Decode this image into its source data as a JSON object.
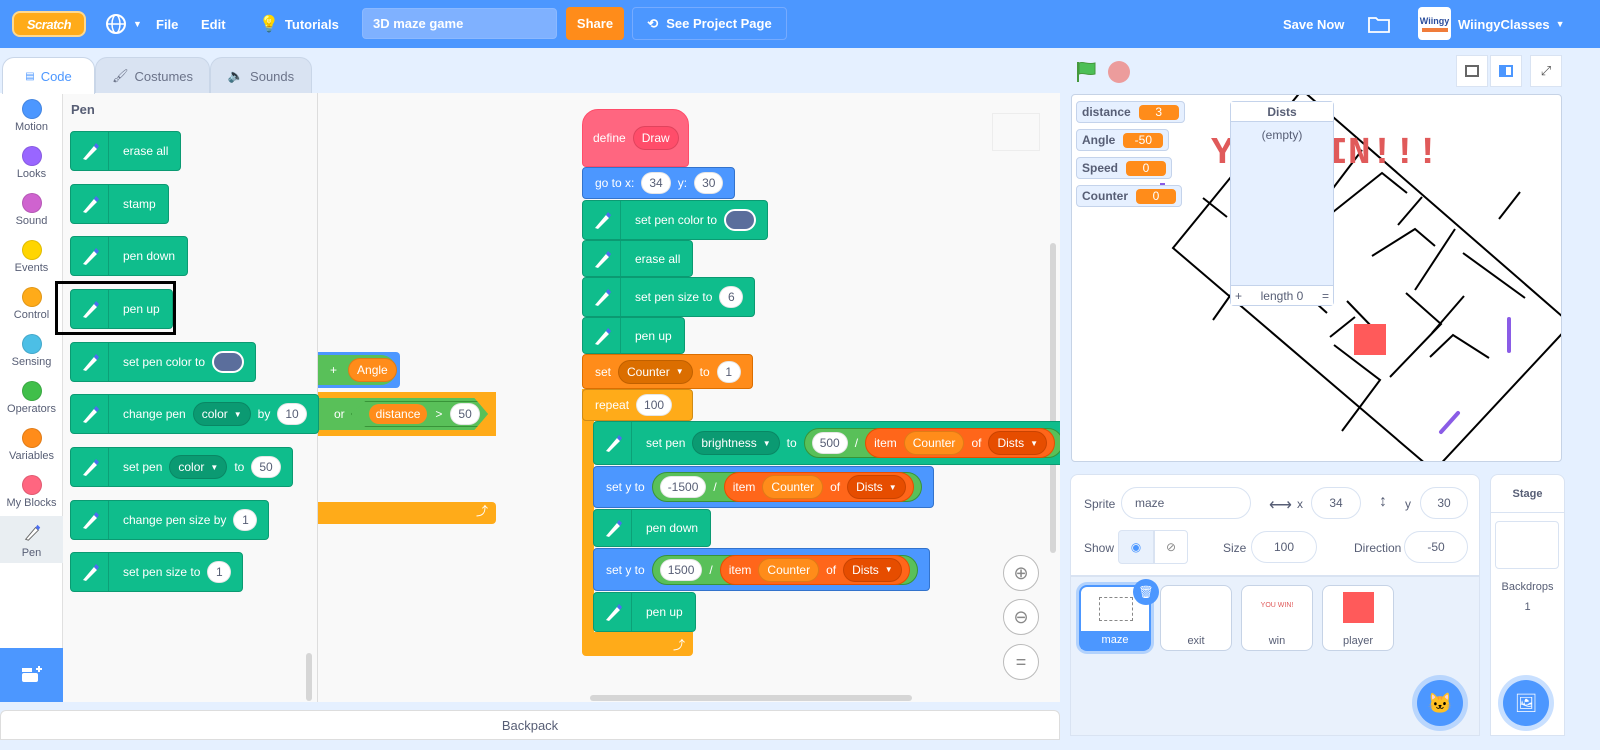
{
  "menu": {
    "logo": "Scratch",
    "file": "File",
    "edit": "Edit",
    "tutorials": "Tutorials",
    "project_title": "3D maze game",
    "share": "Share",
    "see_project_page": "See Project Page",
    "save_now": "Save Now",
    "username": "WiingyClasses",
    "avatar_text": "Wiingy"
  },
  "tabs": {
    "code": "Code",
    "costumes": "Costumes",
    "sounds": "Sounds"
  },
  "categories": [
    {
      "label": "Motion",
      "color": "#4c97ff"
    },
    {
      "label": "Looks",
      "color": "#9966ff"
    },
    {
      "label": "Sound",
      "color": "#cf63cf"
    },
    {
      "label": "Events",
      "color": "#ffd500"
    },
    {
      "label": "Control",
      "color": "#ffab19"
    },
    {
      "label": "Sensing",
      "color": "#4cbfe6"
    },
    {
      "label": "Operators",
      "color": "#40bf4a"
    },
    {
      "label": "Variables",
      "color": "#ff8c1a"
    },
    {
      "label": "My Blocks",
      "color": "#ff6680"
    },
    {
      "label": "Pen",
      "color": "#0fbd8c",
      "selected": true
    }
  ],
  "colors": {
    "pen": "#0fbd8c",
    "motion": "#4c97ff",
    "control": "#ffab19",
    "variables": "#ff8c1a",
    "list": "#ff661a",
    "operators": "#59c059",
    "myblocks": "#ff6680",
    "pen_swatch": "#5b6e9c"
  },
  "palette": {
    "heading": "Pen",
    "highlighted_block": "pen up",
    "blocks": [
      {
        "cat": "pen",
        "parts": [
          {
            "t": "erase all"
          }
        ]
      },
      {
        "cat": "pen",
        "parts": [
          {
            "t": "stamp"
          }
        ]
      },
      {
        "cat": "pen",
        "parts": [
          {
            "t": "pen down"
          }
        ]
      },
      {
        "cat": "pen",
        "parts": [
          {
            "t": "pen up"
          }
        ]
      },
      {
        "cat": "pen",
        "parts": [
          {
            "t": "set pen color to"
          },
          {
            "color": "#5b6e9c"
          }
        ]
      },
      {
        "cat": "pen",
        "parts": [
          {
            "t": "change pen"
          },
          {
            "dd": "color"
          },
          {
            "t": "by"
          },
          {
            "num": "10"
          }
        ]
      },
      {
        "cat": "pen",
        "parts": [
          {
            "t": "set pen"
          },
          {
            "dd": "color"
          },
          {
            "t": "to"
          },
          {
            "num": "50"
          }
        ]
      },
      {
        "cat": "pen",
        "parts": [
          {
            "t": "change pen size by"
          },
          {
            "num": "1"
          }
        ]
      },
      {
        "cat": "pen",
        "parts": [
          {
            "t": "set pen size to"
          },
          {
            "num": "1"
          }
        ]
      }
    ]
  },
  "background_fragments": {
    "plus": "+",
    "angle": "Angle",
    "or": "or",
    "distance": "distance",
    "gt": ">",
    "fifty": "50"
  },
  "script": {
    "blocks": [
      {
        "cat": "myblocks",
        "hat": true,
        "parts": [
          {
            "t": "define"
          },
          {
            "dd": "Draw",
            "nocaret": true
          }
        ]
      },
      {
        "cat": "motion",
        "parts": [
          {
            "t": "go to x:"
          },
          {
            "num": "34"
          },
          {
            "t": "y:"
          },
          {
            "num": "30"
          }
        ]
      },
      {
        "cat": "pen",
        "parts": [
          {
            "t": "set pen color to"
          },
          {
            "color": "#5b6e9c"
          }
        ]
      },
      {
        "cat": "pen",
        "parts": [
          {
            "t": "erase all"
          }
        ]
      },
      {
        "cat": "pen",
        "parts": [
          {
            "t": "set pen size to"
          },
          {
            "num": "6"
          }
        ]
      },
      {
        "cat": "pen",
        "parts": [
          {
            "t": "pen up"
          }
        ]
      },
      {
        "cat": "variables",
        "parts": [
          {
            "t": "set"
          },
          {
            "dd": "Counter"
          },
          {
            "t": "to"
          },
          {
            "num": "1"
          }
        ]
      },
      {
        "cat": "control",
        "parts": [
          {
            "t": "repeat"
          },
          {
            "num": "100"
          }
        ]
      },
      {
        "cat": "pen",
        "parts": [
          {
            "t": "set pen"
          },
          {
            "dd": "brightness"
          },
          {
            "t": "to"
          },
          {
            "rep": {
              "cat": "operators",
              "parts": [
                {
                  "num": "500"
                },
                {
                  "t": "/"
                },
                {
                  "rep": {
                    "cat": "list",
                    "parts": [
                      {
                        "t": "item"
                      },
                      {
                        "dd": "Counter",
                        "nocaret": true,
                        "cat": "variables"
                      },
                      {
                        "t": "of"
                      },
                      {
                        "dd": "Dists"
                      }
                    ]
                  }
                }
              ]
            }
          }
        ]
      },
      {
        "cat": "motion",
        "parts": [
          {
            "t": "set y to"
          },
          {
            "rep": {
              "cat": "operators",
              "parts": [
                {
                  "num": "-1500"
                },
                {
                  "t": "/"
                },
                {
                  "rep": {
                    "cat": "list",
                    "parts": [
                      {
                        "t": "item"
                      },
                      {
                        "dd": "Counter",
                        "nocaret": true,
                        "cat": "variables"
                      },
                      {
                        "t": "of"
                      },
                      {
                        "dd": "Dists"
                      }
                    ]
                  }
                }
              ]
            }
          }
        ]
      },
      {
        "cat": "pen",
        "parts": [
          {
            "t": "pen down"
          }
        ]
      },
      {
        "cat": "motion",
        "parts": [
          {
            "t": "set y to"
          },
          {
            "rep": {
              "cat": "operators",
              "parts": [
                {
                  "num": "1500"
                },
                {
                  "t": "/"
                },
                {
                  "rep": {
                    "cat": "list",
                    "parts": [
                      {
                        "t": "item"
                      },
                      {
                        "dd": "Counter",
                        "nocaret": true,
                        "cat": "variables"
                      },
                      {
                        "t": "of"
                      },
                      {
                        "dd": "Dists"
                      }
                    ]
                  }
                }
              ]
            }
          }
        ]
      },
      {
        "cat": "pen",
        "parts": [
          {
            "t": "pen up"
          }
        ]
      }
    ]
  },
  "backpack": "Backpack",
  "zoom": {
    "in": "+",
    "out": "−",
    "reset": "="
  },
  "stage": {
    "monitors": [
      {
        "label": "distance",
        "value": "3"
      },
      {
        "label": "Angle",
        "value": "-50"
      },
      {
        "label": "Speed",
        "value": "0"
      },
      {
        "label": "Counter",
        "value": "0"
      }
    ],
    "list": {
      "title": "Dists",
      "empty": "(empty)",
      "add": "+",
      "length": "length 0",
      "resize": "="
    },
    "win_text": "YOU WIN!!!"
  },
  "sprite_info": {
    "sprite_label": "Sprite",
    "name": "maze",
    "x_label": "x",
    "x": "34",
    "y_label": "y",
    "y": "30",
    "show_label": "Show",
    "size_label": "Size",
    "size": "100",
    "direction_label": "Direction",
    "direction": "-50"
  },
  "sprites": [
    {
      "name": "maze",
      "selected": true
    },
    {
      "name": "exit"
    },
    {
      "name": "win",
      "thumb_text": "YOU WIN!"
    },
    {
      "name": "player"
    }
  ],
  "stage_pane": {
    "title": "Stage",
    "backdrops_label": "Backdrops",
    "backdrops": "1"
  }
}
